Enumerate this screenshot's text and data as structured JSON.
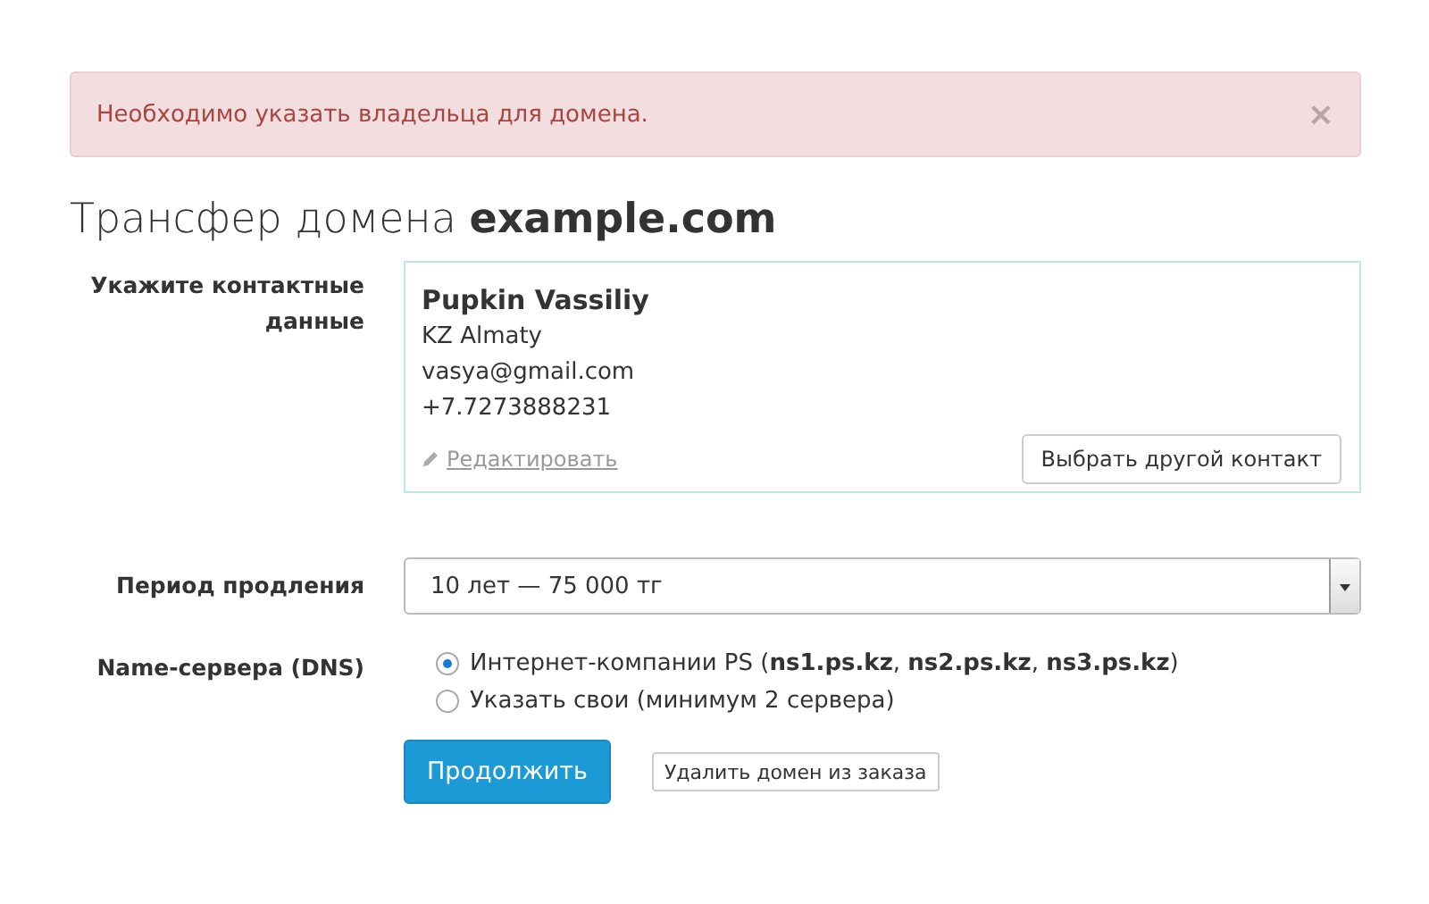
{
  "alert": {
    "message": "Необходимо указать владельца для домена.",
    "close": "×"
  },
  "title": "Трансфер домена **example.com**",
  "contact": {
    "label": "Укажите контактные данные",
    "name": "Pupkin Vassiliy",
    "lines": [
      "KZ Almaty",
      "vasya@gmail.com",
      "+7.7273888231"
    ],
    "edit_link": "Редактировать",
    "change_button": "Выбрать другой контакт"
  },
  "period": {
    "label": "Период продления",
    "value": "10 лет — 75 000 тг"
  },
  "dns": {
    "label": "Name-сервера (DNS)",
    "options": [
      {
        "label": "Интернет-компании PS (**ns1.ps.kz**, **ns2.ps.kz**, **ns3.ps.kz**)",
        "selected": true
      },
      {
        "label": "Указать свои (минимум 2 сервера)",
        "selected": false
      }
    ]
  },
  "buttons": {
    "primary": "Продолжить",
    "secondary": "Удалить домен из заказа"
  }
}
